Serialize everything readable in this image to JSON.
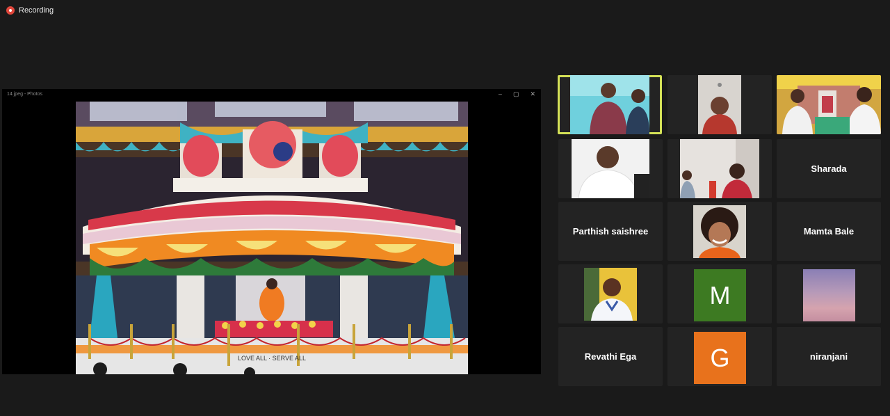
{
  "recording": {
    "label": "Recording",
    "dot_color": "#e0473c"
  },
  "share": {
    "window_title": "14.jpeg - Photos",
    "controls": [
      "–",
      "▢",
      "✕"
    ],
    "photo_caption": "LOVE ALL · SERVE ALL"
  },
  "participants": [
    {
      "type": "video",
      "active": true
    },
    {
      "type": "video"
    },
    {
      "type": "video"
    },
    {
      "type": "video"
    },
    {
      "type": "video"
    },
    {
      "type": "name",
      "name": "Sharada"
    },
    {
      "type": "name",
      "name": "Parthish saishree"
    },
    {
      "type": "image"
    },
    {
      "type": "name",
      "name": "Mamta Bale"
    },
    {
      "type": "image"
    },
    {
      "type": "avatar",
      "letter": "M",
      "color": "#3d7a22"
    },
    {
      "type": "image-gradient"
    },
    {
      "type": "name",
      "name": "Revathi Ega"
    },
    {
      "type": "avatar",
      "letter": "G",
      "color": "#e8721c"
    },
    {
      "type": "name",
      "name": "niranjani"
    }
  ]
}
